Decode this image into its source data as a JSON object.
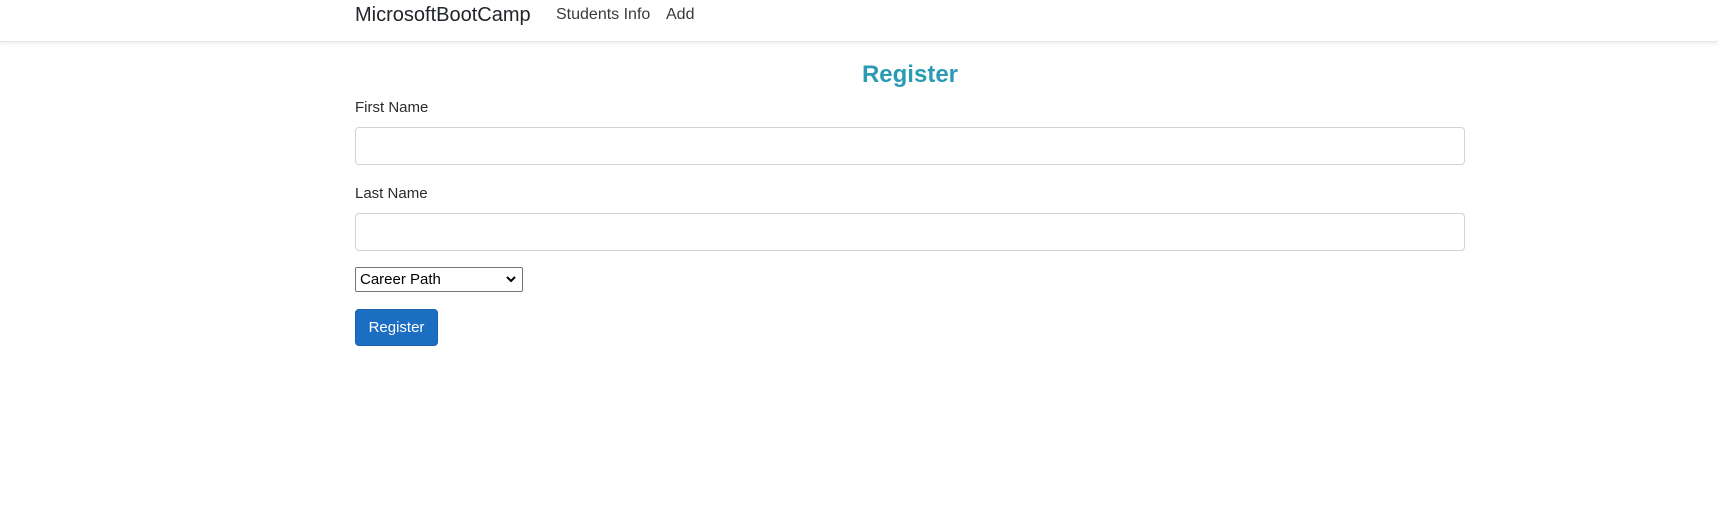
{
  "navbar": {
    "brand": "MicrosoftBootCamp",
    "links": [
      {
        "label": "Students Info"
      },
      {
        "label": "Add"
      }
    ]
  },
  "form": {
    "title": "Register",
    "first_name_label": "First Name",
    "first_name_value": "",
    "last_name_label": "Last Name",
    "last_name_value": "",
    "career_path_selected": "Career Path",
    "submit_label": "Register"
  },
  "colors": {
    "title": "#2a9bb3",
    "button": "#1b6ec2"
  }
}
